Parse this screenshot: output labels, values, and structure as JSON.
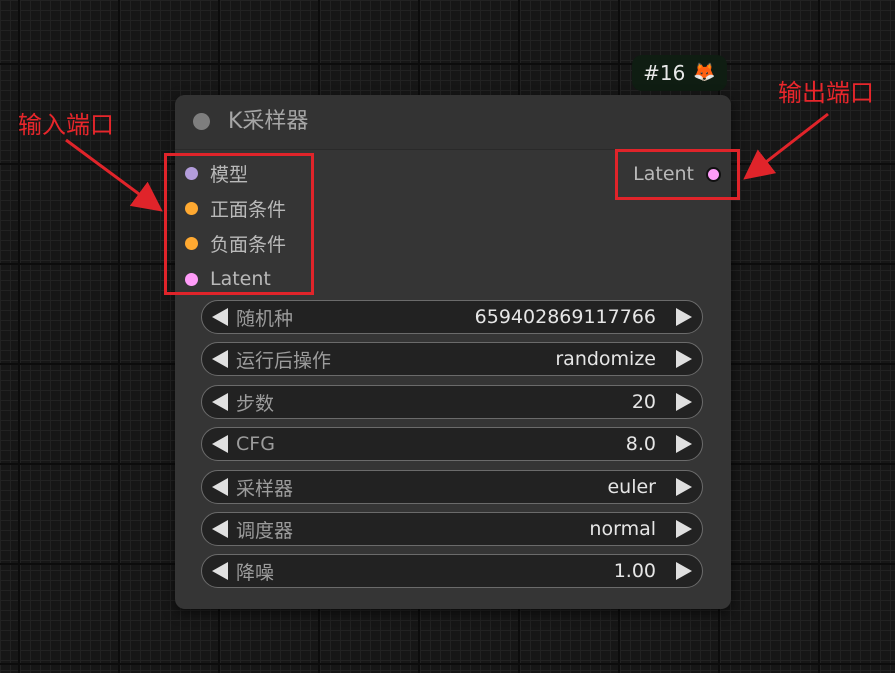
{
  "node": {
    "id_badge": "#16",
    "badge_icon": "fox-emoji",
    "title": "K采样器",
    "inputs": [
      {
        "label": "模型",
        "color": "#b39ddb"
      },
      {
        "label": "正面条件",
        "color": "#ffa931"
      },
      {
        "label": "负面条件",
        "color": "#ffa931"
      },
      {
        "label": "Latent",
        "color": "#ff9cf9"
      }
    ],
    "output": {
      "label": "Latent",
      "color": "#ff9cf9"
    },
    "widgets": [
      {
        "label": "随机种",
        "value": "659402869117766"
      },
      {
        "label": "运行后操作",
        "value": "randomize"
      },
      {
        "label": "步数",
        "value": "20"
      },
      {
        "label": "CFG",
        "value": "8.0"
      },
      {
        "label": "采样器",
        "value": "euler"
      },
      {
        "label": "调度器",
        "value": "normal"
      },
      {
        "label": "降噪",
        "value": "1.00"
      }
    ]
  },
  "annotations": {
    "input_label": "输入端口",
    "output_label": "输出端口",
    "color": "#e0242a"
  }
}
